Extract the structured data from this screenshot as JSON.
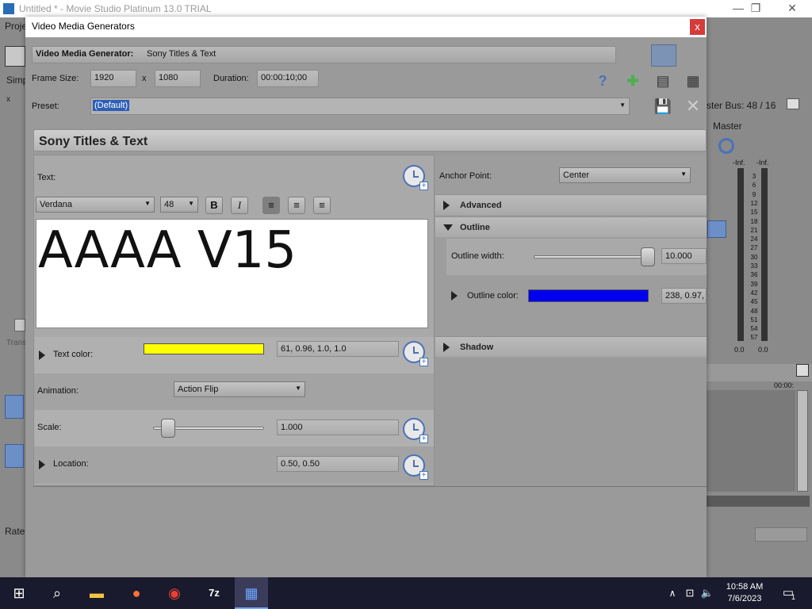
{
  "main_window": {
    "title": "Untitled * - Movie Studio Platinum 13.0 TRIAL",
    "menu_first": "Proje",
    "left_label": "Simp",
    "trans_label": "Trans",
    "rate_label": "Rate:",
    "master_bus": "ster Bus: 48 / 16",
    "master_label": "Master",
    "timecode_right": "00:00:",
    "meter_top_left": "-Inf.",
    "meter_top_right": "-Inf.",
    "meter_scale": [
      "3",
      "6",
      "9",
      "12",
      "15",
      "18",
      "21",
      "24",
      "27",
      "30",
      "33",
      "36",
      "39",
      "42",
      "45",
      "48",
      "51",
      "54",
      "57"
    ],
    "meter_bottom_left": "0.0",
    "meter_bottom_right": "0.0"
  },
  "dialog": {
    "title": "Video Media Generators",
    "close": "x",
    "generator_label": "Video Media Generator:",
    "generator_name": "Sony Titles & Text",
    "frame_size_label": "Frame Size:",
    "frame_width": "1920",
    "frame_x": "x",
    "frame_height": "1080",
    "duration_label": "Duration:",
    "duration_value": "00:00:10;00",
    "preset_label": "Preset:",
    "preset_value": "(Default)"
  },
  "panel": {
    "title": "Sony Titles & Text",
    "text_label": "Text:",
    "font": "Verdana",
    "font_size": "48",
    "bold": "B",
    "italic": "I",
    "content": "AAAA V15",
    "text_color_label": "Text color:",
    "text_color_value": "61, 0.96, 1.0, 1.0",
    "text_color_swatch": "#ffff00",
    "animation_label": "Animation:",
    "animation_value": "Action Flip",
    "scale_label": "Scale:",
    "scale_value": "1.000",
    "location_label": "Location:",
    "location_value": "0.50, 0.50",
    "anchor_label": "Anchor Point:",
    "anchor_value": "Center",
    "advanced_label": "Advanced",
    "outline_label": "Outline",
    "outline_width_label": "Outline width:",
    "outline_width_value": "10.000",
    "outline_color_label": "Outline color:",
    "outline_color_value": "238, 0.97,",
    "outline_color_swatch": "#0000ee",
    "shadow_label": "Shadow"
  },
  "taskbar": {
    "time": "10:58 AM",
    "date": "7/6/2023",
    "notif": "1"
  }
}
